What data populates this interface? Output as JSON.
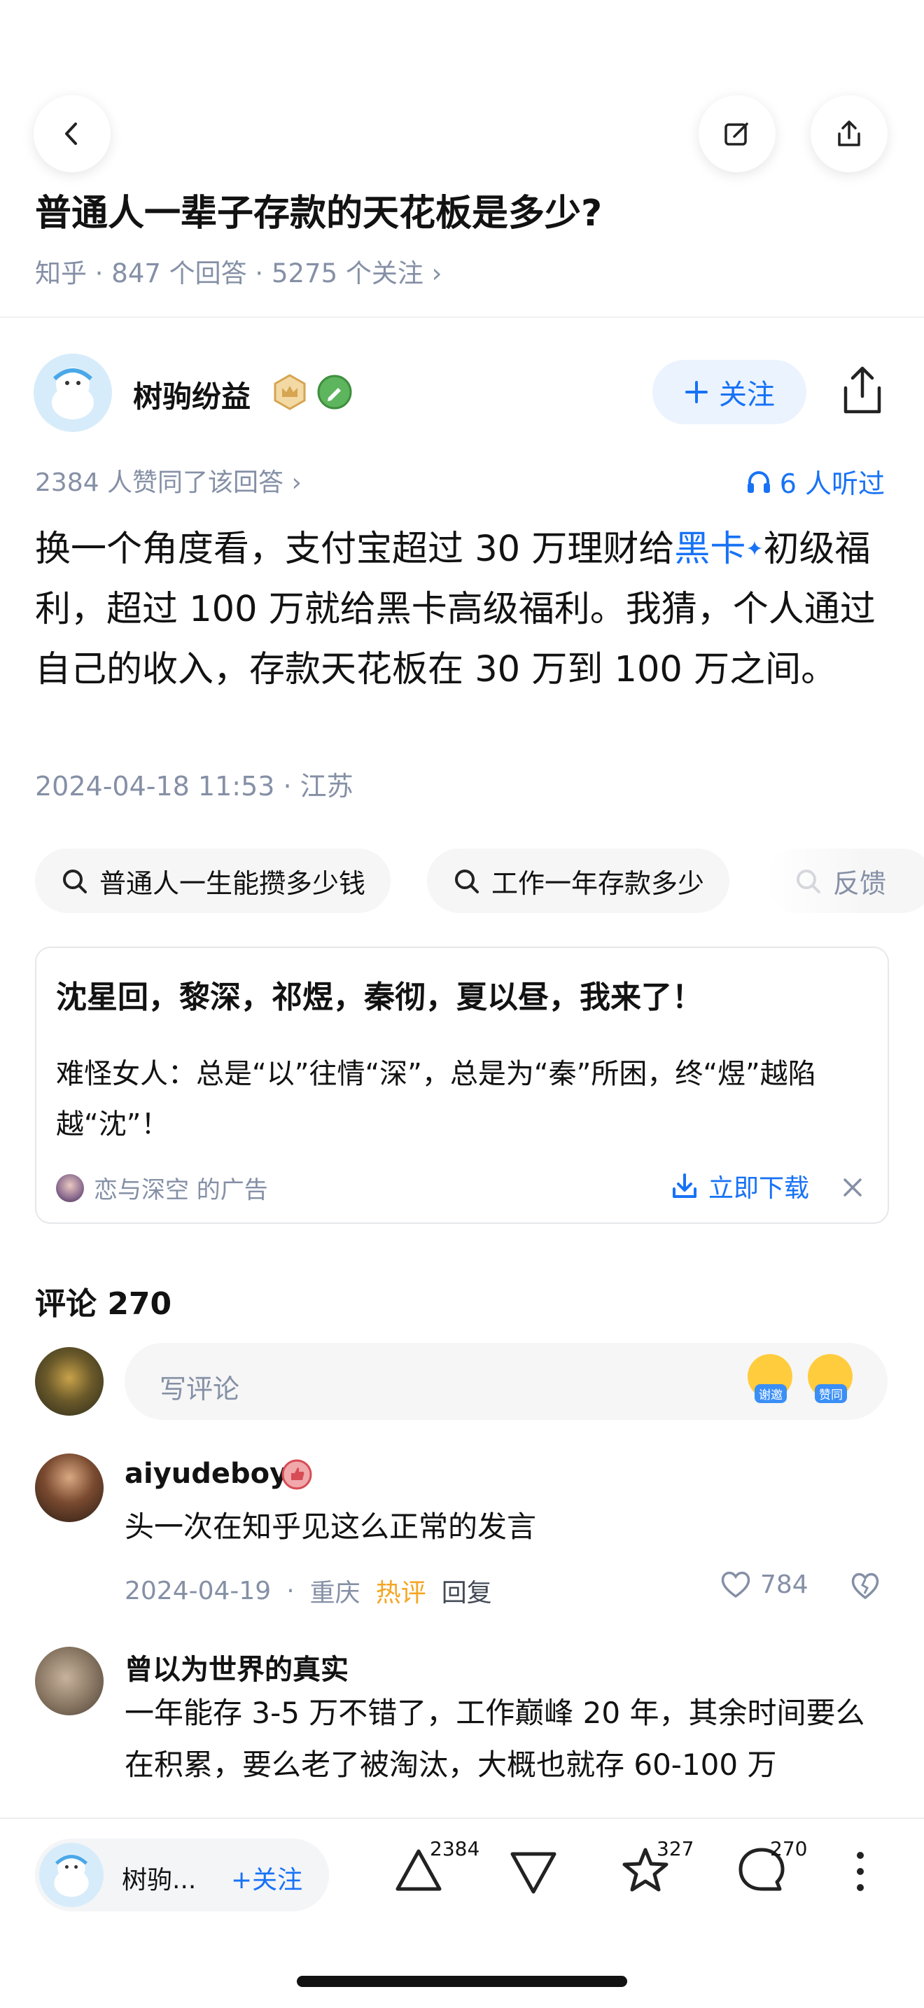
{
  "question": {
    "title": "普通人一辈子存款的天花板是多少?",
    "meta": "知乎 · 847 个回答 · 5275 个关注 ›"
  },
  "answer": {
    "author_name": "树驹纷益",
    "follow_label": "关注",
    "agree_text": "2384 人赞同了该回答 ›",
    "listen_text": "6 人听过",
    "body_pre": "换一个角度看，支付宝超过 30 万理财给",
    "body_link": "黑卡",
    "body_post": "初级福利，超过 100 万就给黑卡高级福利。我猜，个人通过自己的收入，存款天花板在 30 万到 100 万之间。",
    "date": "2024-04-18 11:53 · 江苏"
  },
  "related_searches": [
    "普通人一生能攒多少钱",
    "工作一年存款多少",
    "反馈"
  ],
  "ad": {
    "title": "沈星回，黎深，祁煜，秦彻，夏以昼，我来了！",
    "desc": "难怪女人：总是“以”往情“深”，总是为“秦”所困，终“煜”越陷越“沈”！",
    "source": "恋与深空 的广告",
    "download_label": "立即下载"
  },
  "comments_header": "评论 270",
  "comment_input": {
    "placeholder": "写评论",
    "emoji_tags": [
      "谢邀",
      "赞同"
    ]
  },
  "comments": [
    {
      "name": "aiyudeboy",
      "text": "头一次在知乎见这么正常的发言",
      "date": "2024-04-19",
      "location": "重庆",
      "hot": "热评",
      "reply": "回复",
      "likes": "784"
    },
    {
      "name": "曾以为世界的真实",
      "text": "一年能存 3-5 万不错了，工作巅峰 20 年，其余时间要么在积累，要么老了被淘汰，大概也就存 60-100 万"
    }
  ],
  "bottom_bar": {
    "author_short": "树驹...",
    "follow_label": "+关注",
    "upvotes": "2384",
    "favorites": "327",
    "comments": "270"
  },
  "colors": {
    "accent": "#1772f6",
    "meta_gray": "#8590a6",
    "hot_orange": "#f5a623"
  }
}
